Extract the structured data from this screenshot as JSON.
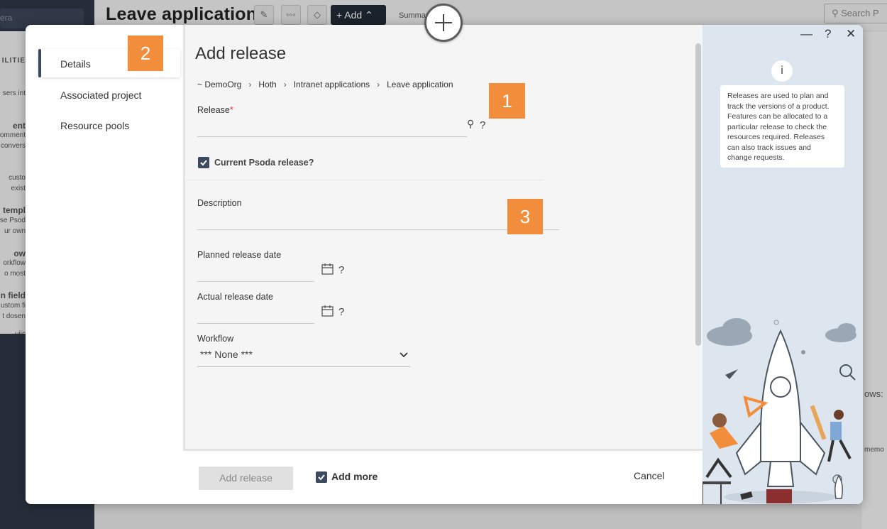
{
  "background": {
    "page_title": "Leave application",
    "add_button_label": "Add",
    "summary_label": "Summar",
    "search_placeholder": "Search P",
    "sidebar_search_text": "era",
    "sidebar_fragments": [
      "ILITIE",
      "sers int",
      "ent",
      "omment",
      "convers",
      "custo",
      "exist",
      "templ",
      "se Psod",
      "ur own",
      "ow",
      "orkflow",
      "o most",
      "n field",
      "ustom fi",
      "t dosen",
      "uiic"
    ],
    "right_fragment_1": "ows:",
    "right_fragment_2": "memo"
  },
  "modal": {
    "title": "Add release",
    "nav": [
      {
        "label": "Details"
      },
      {
        "label": "Associated project"
      },
      {
        "label": "Resource pools"
      }
    ],
    "breadcrumb": [
      "~ DemoOrg",
      "Hoth",
      "Intranet applications",
      "Leave application"
    ],
    "fields": {
      "release_label": "Release",
      "required_marker": "*",
      "current_release_label": "Current Psoda release?",
      "description_label": "Description",
      "planned_label": "Planned release date",
      "actual_label": "Actual release date",
      "workflow_label": "Workflow",
      "workflow_value": "*** None ***",
      "help_mark": "?"
    },
    "footer": {
      "add_release": "Add release",
      "add_more": "Add more",
      "cancel": "Cancel"
    },
    "help": {
      "info_glyph": "i",
      "text": "Releases are used to plan and track the versions of a product. Features can be allocated to a particular release to check the resources required. Releases can also track issues and change requests.",
      "minimize": "—",
      "question": "?",
      "close": "✕"
    },
    "badges": [
      "1",
      "2",
      "3"
    ]
  },
  "accent_colors": {
    "badge": "#f28e3b",
    "nav_active": "#3b4a5e"
  }
}
